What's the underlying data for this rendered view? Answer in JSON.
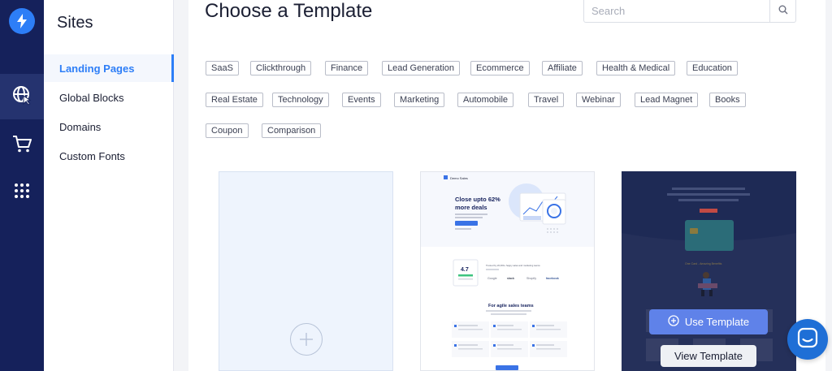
{
  "app": {
    "accent": "#2d7ef7",
    "rail_color": "#15215b"
  },
  "rail": {
    "items": [
      {
        "icon": "globe-icon",
        "active": true
      },
      {
        "icon": "cart-icon",
        "active": false
      },
      {
        "icon": "apps-grid-icon",
        "active": false
      }
    ]
  },
  "sidebar": {
    "title": "Sites",
    "items": [
      {
        "label": "Landing Pages",
        "active": true
      },
      {
        "label": "Global Blocks",
        "active": false
      },
      {
        "label": "Domains",
        "active": false
      },
      {
        "label": "Custom Fonts",
        "active": false
      }
    ]
  },
  "main": {
    "title": "Choose a Template",
    "search": {
      "placeholder": "Search",
      "value": ""
    },
    "tags": [
      "SaaS",
      "Clickthrough",
      "Finance",
      "Lead Generation",
      "Ecommerce",
      "Affiliate",
      "Health & Medical",
      "Education",
      "Real Estate",
      "Technology",
      "Events",
      "Marketing",
      "Automobile",
      "Travel",
      "Webinar",
      "Lead Magnet",
      "Books",
      "Coupon",
      "Comparison"
    ],
    "template1": {
      "brand": "Demo Sales",
      "headline_1": "Close upto 62%",
      "headline_2": "more deals",
      "rating": "4.7",
      "trusted_text": "Trusted by 20,000+ happy sales and marketing teams",
      "logos": [
        "Google",
        "slack",
        "Shopify",
        "facebook"
      ],
      "section_title": "For agile sales teams"
    },
    "template2": {
      "caption": "One Card - Amazing Benefits"
    },
    "use_template_label": "Use Template",
    "view_template_label": "View Template"
  },
  "chat": {
    "icon": "chat-icon"
  }
}
